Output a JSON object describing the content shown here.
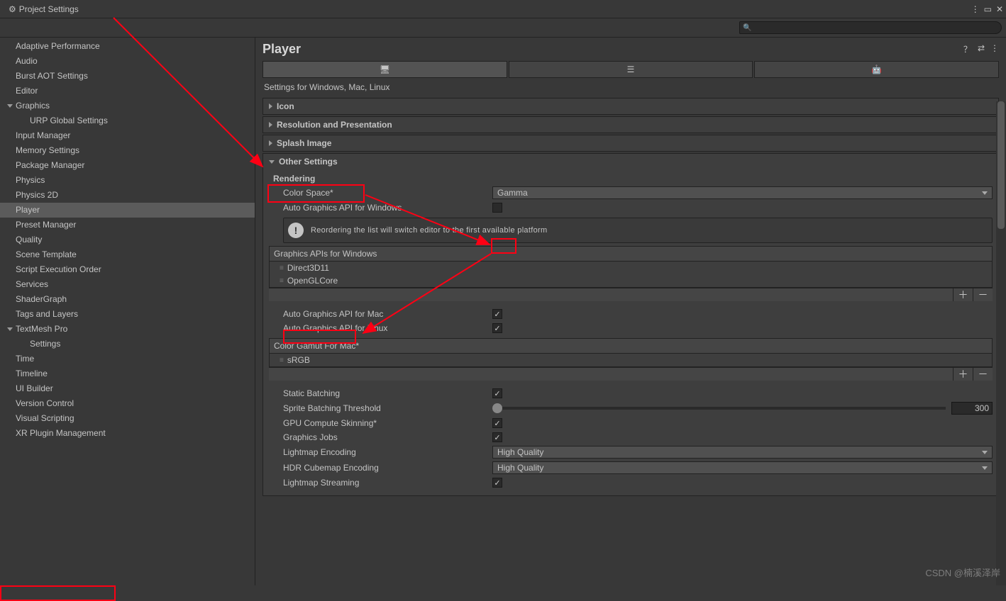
{
  "window": {
    "title": "Project Settings"
  },
  "sidebar": {
    "items": [
      {
        "label": "Adaptive Performance",
        "indent": 0
      },
      {
        "label": "Audio",
        "indent": 0
      },
      {
        "label": "Burst AOT Settings",
        "indent": 0
      },
      {
        "label": "Editor",
        "indent": 0
      },
      {
        "label": "Graphics",
        "indent": 0,
        "expandable": true
      },
      {
        "label": "URP Global Settings",
        "indent": 1
      },
      {
        "label": "Input Manager",
        "indent": 0
      },
      {
        "label": "Memory Settings",
        "indent": 0
      },
      {
        "label": "Package Manager",
        "indent": 0
      },
      {
        "label": "Physics",
        "indent": 0
      },
      {
        "label": "Physics 2D",
        "indent": 0
      },
      {
        "label": "Player",
        "indent": 0,
        "selected": true
      },
      {
        "label": "Preset Manager",
        "indent": 0
      },
      {
        "label": "Quality",
        "indent": 0
      },
      {
        "label": "Scene Template",
        "indent": 0
      },
      {
        "label": "Script Execution Order",
        "indent": 0
      },
      {
        "label": "Services",
        "indent": 0
      },
      {
        "label": "ShaderGraph",
        "indent": 0
      },
      {
        "label": "Tags and Layers",
        "indent": 0
      },
      {
        "label": "TextMesh Pro",
        "indent": 0,
        "expandable": true
      },
      {
        "label": "Settings",
        "indent": 1
      },
      {
        "label": "Time",
        "indent": 0
      },
      {
        "label": "Timeline",
        "indent": 0
      },
      {
        "label": "UI Builder",
        "indent": 0
      },
      {
        "label": "Version Control",
        "indent": 0
      },
      {
        "label": "Visual Scripting",
        "indent": 0
      },
      {
        "label": "XR Plugin Management",
        "indent": 0
      }
    ]
  },
  "content": {
    "title": "Player",
    "platform_subtitle": "Settings for Windows, Mac, Linux",
    "sections": {
      "icon": "Icon",
      "resolution": "Resolution and Presentation",
      "splash": "Splash Image",
      "other": "Other Settings"
    },
    "rendering": {
      "heading": "Rendering",
      "color_space_label": "Color Space*",
      "color_space_value": "Gamma",
      "auto_api_windows_label": "Auto Graphics API  for Windows",
      "auto_api_windows_checked": false,
      "reorder_info": "Reordering the list will switch editor to the first available platform",
      "graphics_api_list_title": "Graphics APIs for Windows",
      "graphics_api_items": [
        "Direct3D11",
        "OpenGLCore"
      ],
      "auto_api_mac_label": "Auto Graphics API  for Mac",
      "auto_api_linux_label": "Auto Graphics API  for Linux",
      "color_gamut_title": "Color Gamut For Mac*",
      "color_gamut_items": [
        "sRGB"
      ],
      "static_batching_label": "Static Batching",
      "sprite_threshold_label": "Sprite Batching Threshold",
      "sprite_threshold_value": "300",
      "gpu_skinning_label": "GPU Compute Skinning*",
      "graphics_jobs_label": "Graphics Jobs",
      "lightmap_encoding_label": "Lightmap Encoding",
      "lightmap_encoding_value": "High Quality",
      "hdr_cubemap_label": "HDR Cubemap Encoding",
      "hdr_cubemap_value": "High Quality",
      "lightmap_streaming_label": "Lightmap Streaming"
    }
  },
  "watermark": "CSDN @楠溪泽岸"
}
